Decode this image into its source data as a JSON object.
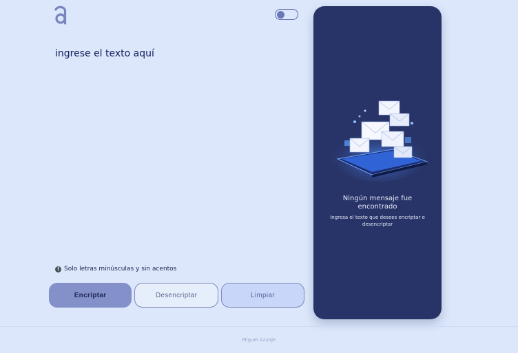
{
  "header": {
    "logo_icon": "a-logo-icon",
    "theme_toggle_icon": "toggle-switch-icon"
  },
  "input": {
    "placeholder": "ingrese el texto aquí",
    "value": ""
  },
  "hint": {
    "icon": "info-icon",
    "text": "Solo letras minúsculas y sin acentos"
  },
  "buttons": {
    "encrypt": "Encriptar",
    "decrypt": "Desencriptar",
    "clear": "Limpiar"
  },
  "output_panel": {
    "illustration": "envelopes-on-laptop-illustration",
    "title": "Ningún mensaje fue encontrado",
    "subtitle": "Ingresa el texto que desees encriptar o desencriptar"
  },
  "footer": {
    "author": "Miguel Azuaje"
  },
  "colors": {
    "background": "#dce7fb",
    "panel": "#283468",
    "accent": "#8390c9"
  }
}
